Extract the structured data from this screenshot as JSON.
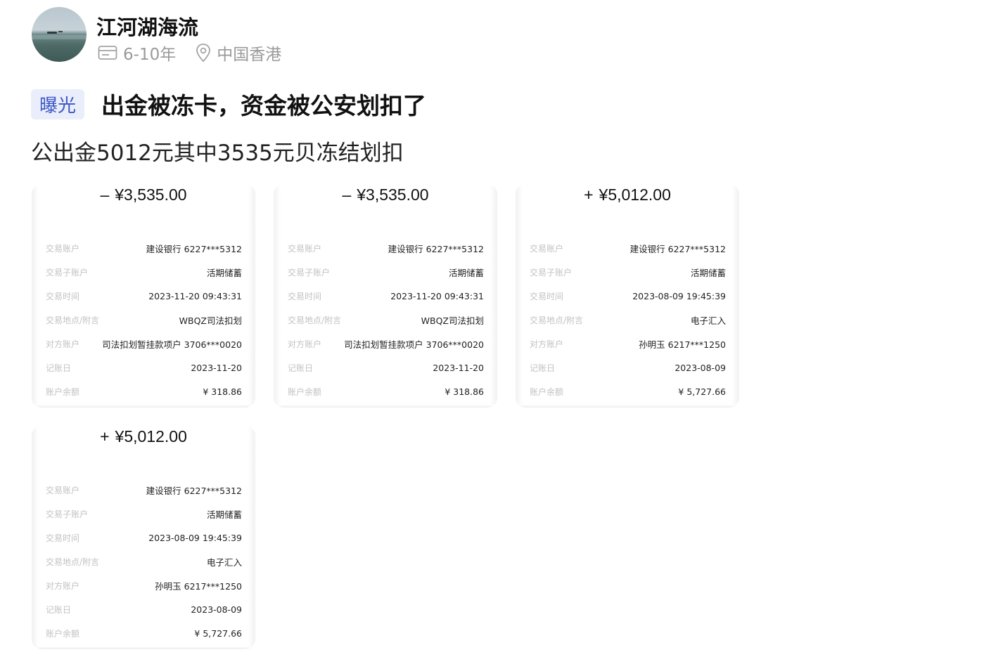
{
  "user": {
    "name": "江河湖海流",
    "experience": "6-10年",
    "location": "中国香港"
  },
  "post": {
    "tag": "曝光",
    "title": "出金被冻卡，资金被公安划扣了",
    "body": "公出金5012元其中3535元贝冻结划扣"
  },
  "cards": [
    {
      "sign": "–",
      "amount": "¥3,535.00",
      "rows": [
        {
          "k": "交易账户",
          "v": "建设银行 6227***5312"
        },
        {
          "k": "交易子账户",
          "v": "活期储蓄"
        },
        {
          "k": "交易时间",
          "v": "2023-11-20 09:43:31"
        },
        {
          "k": "交易地点/附言",
          "v": "WBQZ司法扣划"
        },
        {
          "k": "对方账户",
          "v": "司法扣划暂挂款项户 3706***0020"
        },
        {
          "k": "记账日",
          "v": "2023-11-20"
        },
        {
          "k": "账户余额",
          "v": "¥ 318.86"
        }
      ]
    },
    {
      "sign": "–",
      "amount": "¥3,535.00",
      "rows": [
        {
          "k": "交易账户",
          "v": "建设银行 6227***5312"
        },
        {
          "k": "交易子账户",
          "v": "活期储蓄"
        },
        {
          "k": "交易时间",
          "v": "2023-11-20 09:43:31"
        },
        {
          "k": "交易地点/附言",
          "v": "WBQZ司法扣划"
        },
        {
          "k": "对方账户",
          "v": "司法扣划暂挂款项户 3706***0020"
        },
        {
          "k": "记账日",
          "v": "2023-11-20"
        },
        {
          "k": "账户余额",
          "v": "¥ 318.86"
        }
      ]
    },
    {
      "sign": "+",
      "amount": "¥5,012.00",
      "rows": [
        {
          "k": "交易账户",
          "v": "建设银行 6227***5312"
        },
        {
          "k": "交易子账户",
          "v": "活期储蓄"
        },
        {
          "k": "交易时间",
          "v": "2023-08-09 19:45:39"
        },
        {
          "k": "交易地点/附言",
          "v": "电子汇入"
        },
        {
          "k": "对方账户",
          "v": "孙明玉 6217***1250"
        },
        {
          "k": "记账日",
          "v": "2023-08-09"
        },
        {
          "k": "账户余额",
          "v": "¥ 5,727.66"
        }
      ]
    },
    {
      "sign": "+",
      "amount": "¥5,012.00",
      "rows": [
        {
          "k": "交易账户",
          "v": "建设银行 6227***5312"
        },
        {
          "k": "交易子账户",
          "v": "活期储蓄"
        },
        {
          "k": "交易时间",
          "v": "2023-08-09 19:45:39"
        },
        {
          "k": "交易地点/附言",
          "v": "电子汇入"
        },
        {
          "k": "对方账户",
          "v": "孙明玉 6217***1250"
        },
        {
          "k": "记账日",
          "v": "2023-08-09"
        },
        {
          "k": "账户余额",
          "v": "¥ 5,727.66"
        }
      ]
    }
  ],
  "icons": {
    "experience": "id-card-icon",
    "location": "location-pin-icon"
  },
  "colors": {
    "tag_bg": "#eaeefb",
    "tag_text": "#3d56c7",
    "meta_text": "#9a9a9a"
  }
}
